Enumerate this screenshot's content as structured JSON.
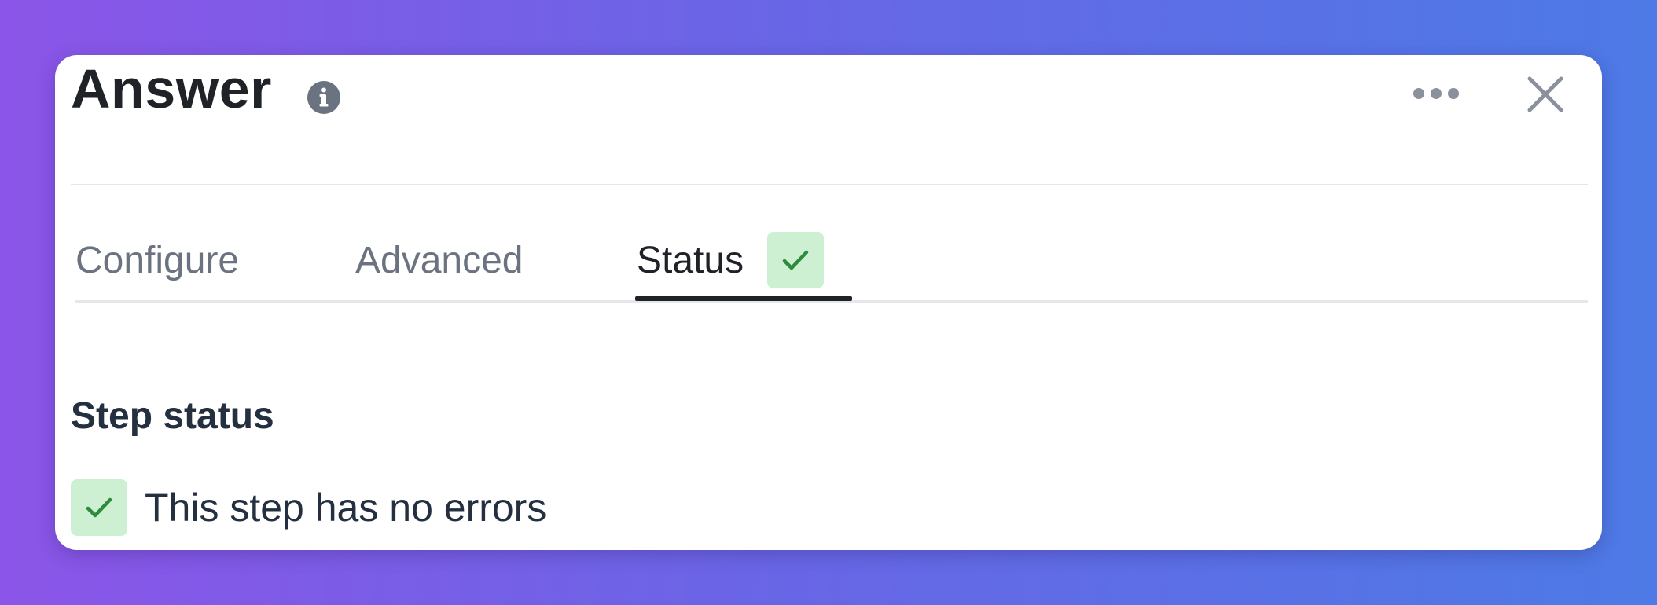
{
  "panel": {
    "title": "Answer",
    "info_icon": "info-icon",
    "more_icon": "more-horizontal-icon",
    "close_icon": "close-icon"
  },
  "tabs": [
    {
      "label": "Configure",
      "active": false
    },
    {
      "label": "Advanced",
      "active": false
    },
    {
      "label": "Status",
      "active": true,
      "badge_icon": "check-icon"
    }
  ],
  "status": {
    "section_title": "Step status",
    "message": "This step has no errors",
    "icon": "check-icon"
  },
  "colors": {
    "background_start": "#8b55e8",
    "background_end": "#4d7ae6",
    "success_bg": "#cdefd2",
    "success_fg": "#2e8b3e",
    "active_tab": "#1f2328",
    "inactive_tab": "#6b7280"
  }
}
